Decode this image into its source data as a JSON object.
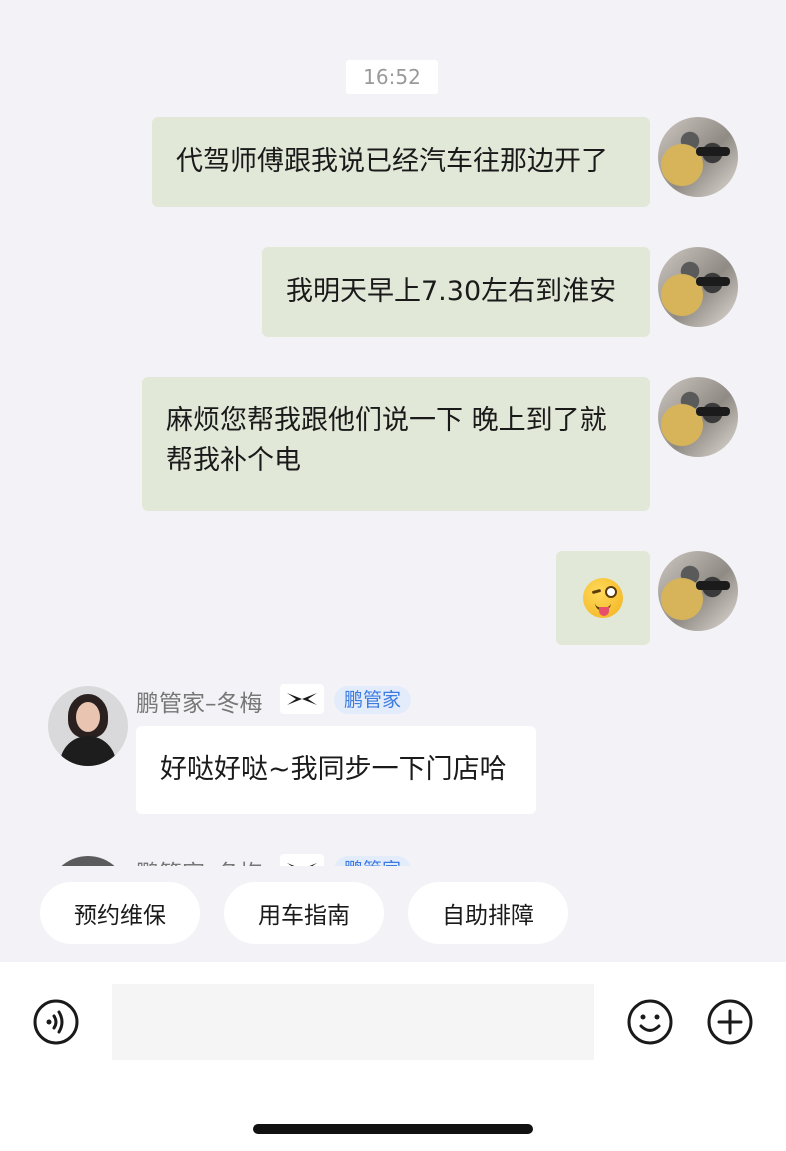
{
  "chat": {
    "timestamp": "16:52",
    "outgoing": [
      {
        "text": "代驾师傅跟我说已经汽车往那边开了"
      },
      {
        "text": "我明天早上7.30左右到淮安"
      },
      {
        "text": "麻烦您帮我跟他们说一下 晚上到了就帮我补个电"
      },
      {
        "emoji": "winking-face-with-tongue"
      }
    ],
    "incoming": {
      "sender_name": "鹏管家–冬梅",
      "role_badge": "鹏管家",
      "text": "好哒好哒~我同步一下门店哈"
    },
    "incoming_partial": {
      "sender_name": "鹏管家–冬梅",
      "role_badge": "鹏管家"
    }
  },
  "quick_actions": [
    "预约维保",
    "用车指南",
    "自助排障"
  ],
  "input": {
    "value": "",
    "placeholder": ""
  },
  "icons": {
    "voice": "voice-icon",
    "emoji": "emoji-icon",
    "plus": "plus-icon"
  },
  "colors": {
    "outgoing_bubble": "#e1e8d8",
    "incoming_bubble": "#ffffff",
    "badge_text": "#3d7be0",
    "badge_bg": "#e3ecfa"
  }
}
